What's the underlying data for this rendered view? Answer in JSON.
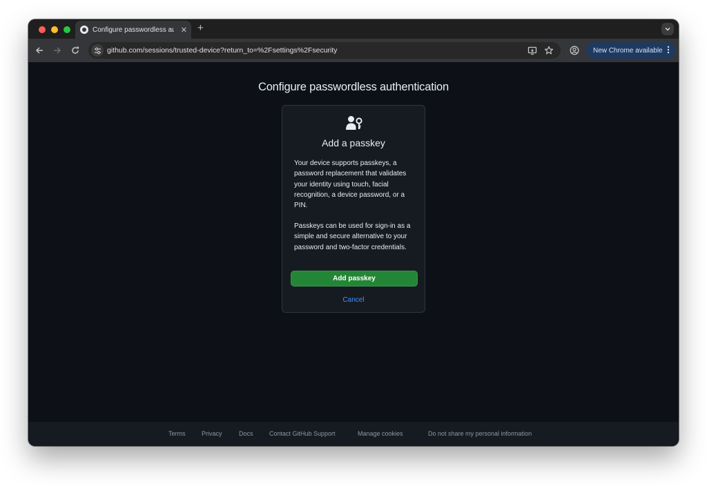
{
  "browser": {
    "tab": {
      "title": "Configure passwordless auth"
    },
    "address_bar": {
      "url": "github.com/sessions/trusted-device?return_to=%2Fsettings%2Fsecurity"
    },
    "update_button": {
      "label": "New Chrome available"
    }
  },
  "page": {
    "title": "Configure passwordless authentication",
    "card": {
      "heading": "Add a passkey",
      "paragraph_1": "Your device supports passkeys, a password replacement that validates your identity using touch, facial recognition, a device password, or a PIN.",
      "paragraph_2": "Passkeys can be used for sign-in as a simple and secure alternative to your password and two-factor credentials.",
      "primary_button": "Add passkey",
      "cancel_link": "Cancel"
    }
  },
  "footer": {
    "links": [
      "Terms",
      "Privacy",
      "Docs",
      "Contact GitHub Support",
      "Manage cookies",
      "Do not share my personal information"
    ]
  },
  "colors": {
    "page_bg": "#0d1117",
    "card_bg": "#161b22",
    "primary_button": "#238636",
    "link": "#4493f8",
    "chrome_update_pill": "#1f3a5f"
  },
  "icons": [
    "github-favicon",
    "close-icon",
    "plus-icon",
    "chevron-down-icon",
    "back-arrow-icon",
    "forward-arrow-icon",
    "reload-icon",
    "site-info-icon",
    "install-app-icon",
    "star-icon",
    "profile-icon",
    "more-vert-icon",
    "passkey-icon"
  ]
}
